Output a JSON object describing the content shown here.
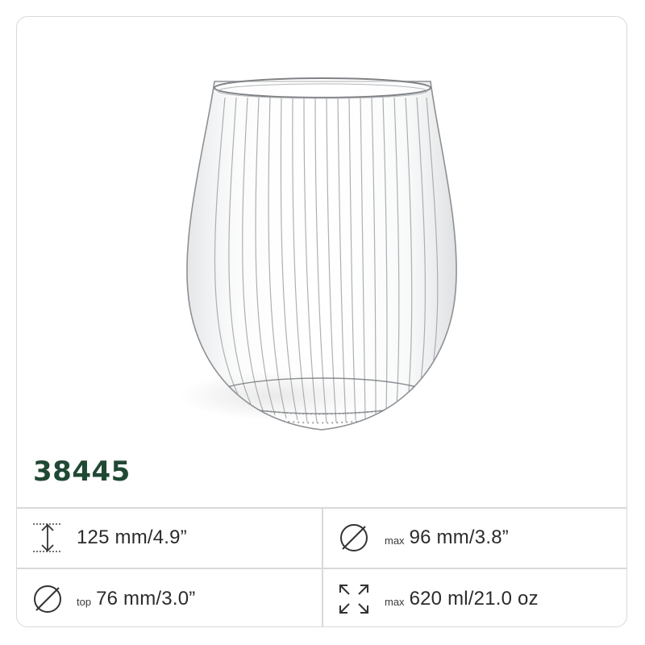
{
  "product": {
    "code": "38445",
    "image_label": "ribbed stemless glass"
  },
  "specs": [
    {
      "icon": "height-icon",
      "qualifier": "",
      "value": "125 mm/4.9”"
    },
    {
      "icon": "diameter-icon",
      "qualifier": "max",
      "value": "96 mm/3.8”"
    },
    {
      "icon": "diameter-icon",
      "qualifier": "top",
      "value": "76 mm/3.0”"
    },
    {
      "icon": "capacity-icon",
      "qualifier": "max",
      "value": "620 ml/21.0 oz"
    }
  ],
  "colors": {
    "brand_green": "#1e4a33",
    "border": "#d9d9d9",
    "text": "#2b2b2b"
  }
}
